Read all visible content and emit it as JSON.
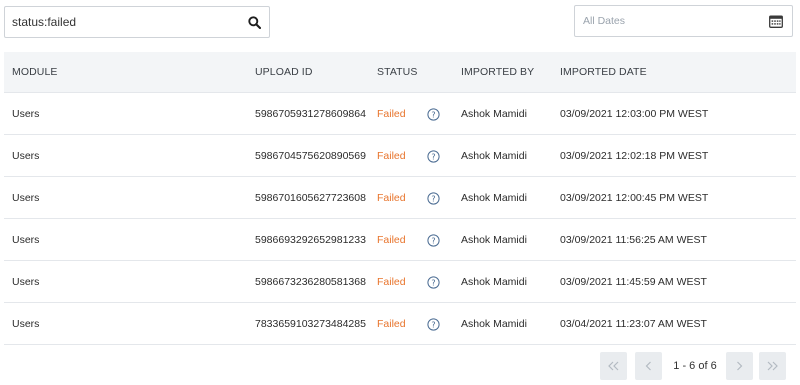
{
  "search": {
    "value": "status:failed",
    "icon": "search-icon"
  },
  "date_filter": {
    "placeholder": "All Dates",
    "icon": "calendar-icon"
  },
  "table": {
    "headers": {
      "module": "MODULE",
      "upload_id": "UPLOAD ID",
      "status": "STATUS",
      "imported_by": "IMPORTED BY",
      "imported_date": "IMPORTED DATE"
    },
    "rows": [
      {
        "module": "Users",
        "upload_id": "5986705931278609864",
        "status": "Failed",
        "imported_by": "Ashok Mamidi",
        "imported_date": "03/09/2021 12:03:00 PM WEST"
      },
      {
        "module": "Users",
        "upload_id": "5986704575620890569",
        "status": "Failed",
        "imported_by": "Ashok Mamidi",
        "imported_date": "03/09/2021 12:02:18 PM WEST"
      },
      {
        "module": "Users",
        "upload_id": "5986701605627723608",
        "status": "Failed",
        "imported_by": "Ashok Mamidi",
        "imported_date": "03/09/2021 12:00:45 PM WEST"
      },
      {
        "module": "Users",
        "upload_id": "5986693292652981233",
        "status": "Failed",
        "imported_by": "Ashok Mamidi",
        "imported_date": "03/09/2021 11:56:25 AM WEST"
      },
      {
        "module": "Users",
        "upload_id": "5986673236280581368",
        "status": "Failed",
        "imported_by": "Ashok Mamidi",
        "imported_date": "03/09/2021 11:45:59 AM WEST"
      },
      {
        "module": "Users",
        "upload_id": "7833659103273484285",
        "status": "Failed",
        "imported_by": "Ashok Mamidi",
        "imported_date": "03/04/2021 11:23:07 AM WEST"
      }
    ]
  },
  "pagination": {
    "info": "1 - 6 of 6"
  },
  "colors": {
    "status_failed": "#e8742c",
    "header_bg": "#f3f5f7",
    "pager_bg": "#e9ecef"
  }
}
